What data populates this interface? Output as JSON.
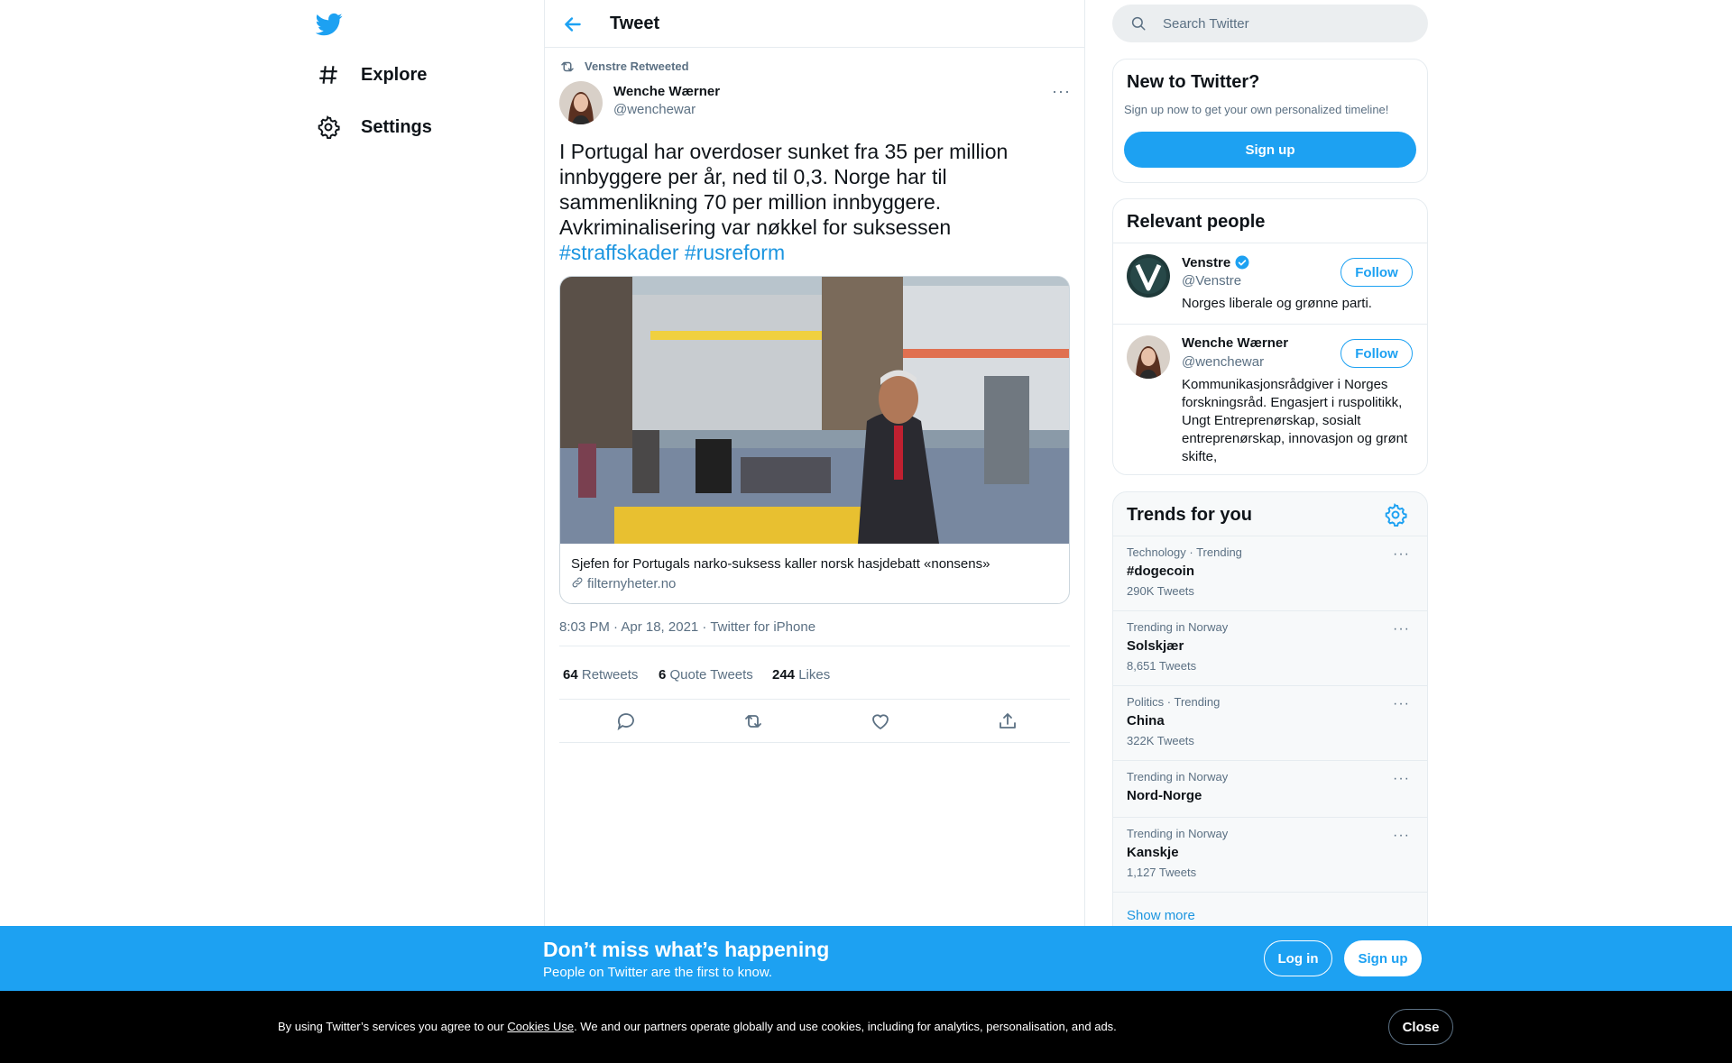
{
  "nav": {
    "logo_icon": "twitter-bird-icon",
    "items": [
      {
        "label": "Explore",
        "icon": "hashtag-icon"
      },
      {
        "label": "Settings",
        "icon": "gear-icon"
      }
    ]
  },
  "header": {
    "title": "Tweet",
    "back_icon": "arrow-left-icon"
  },
  "tweet": {
    "retweeted_by": "Venstre Retweeted",
    "author_name": "Wenche Wærner",
    "author_handle": "@wenchewar",
    "text": "I Portugal har overdoser sunket fra 35 per million innbyggere per år, ned til 0,3. Norge har til sammenlikning 70 per million innbyggere. Avkriminalisering var nøkkel for suksessen ",
    "hashtags": [
      "#straffskader",
      "#rusreform"
    ],
    "card": {
      "title": "Sjefen for Portugals narko-suksess kaller norsk hasjdebatt «nonsens»",
      "domain": "filternyheter.no"
    },
    "timestamp": "8:03 PM · Apr 18, 2021 · Twitter for iPhone",
    "stats": {
      "retweets_count": "64",
      "retweets_label": "Retweets",
      "quotes_count": "6",
      "quotes_label": "Quote Tweets",
      "likes_count": "244",
      "likes_label": "Likes"
    },
    "more_label": "···"
  },
  "search": {
    "placeholder": "Search Twitter"
  },
  "new_to_twitter": {
    "title": "New to Twitter?",
    "subtitle": "Sign up now to get your own personalized timeline!",
    "button": "Sign up"
  },
  "relevant_people": {
    "title": "Relevant people",
    "people": [
      {
        "name": "Venstre",
        "verified": true,
        "handle": "@Venstre",
        "bio": "Norges liberale og grønne parti.",
        "follow": "Follow"
      },
      {
        "name": "Wenche Wærner",
        "verified": false,
        "handle": "@wenchewar",
        "bio": "Kommunikasjonsrådgiver i Norges forskningsråd. Engasjert i ruspolitikk, Ungt Entreprenørskap, sosialt entreprenørskap, innovasjon og grønt skifte,",
        "follow": "Follow"
      }
    ]
  },
  "trends": {
    "title": "Trends for you",
    "items": [
      {
        "meta": "Technology · Trending",
        "name": "#dogecoin",
        "count": "290K Tweets"
      },
      {
        "meta": "Trending in Norway",
        "name": "Solskjær",
        "count": "8,651 Tweets"
      },
      {
        "meta": "Politics · Trending",
        "name": "China",
        "count": "322K Tweets"
      },
      {
        "meta": "Trending in Norway",
        "name": "Nord-Norge",
        "count": ""
      },
      {
        "meta": "Trending in Norway",
        "name": "Kanskje",
        "count": "1,127 Tweets"
      }
    ],
    "show_more": "Show more"
  },
  "signup_bar": {
    "title": "Don’t miss what’s happening",
    "subtitle": "People on Twitter are the first to know.",
    "login": "Log in",
    "signup": "Sign up"
  },
  "cookie_bar": {
    "text_before": "By using Twitter’s services you agree to our ",
    "link": "Cookies Use",
    "text_after": ". We and our partners operate globally and use cookies, including for analytics, personalisation, and ads.",
    "close": "Close"
  },
  "colors": {
    "accent": "#1da1f2",
    "link": "#1b95e0",
    "muted": "#5b7083"
  }
}
